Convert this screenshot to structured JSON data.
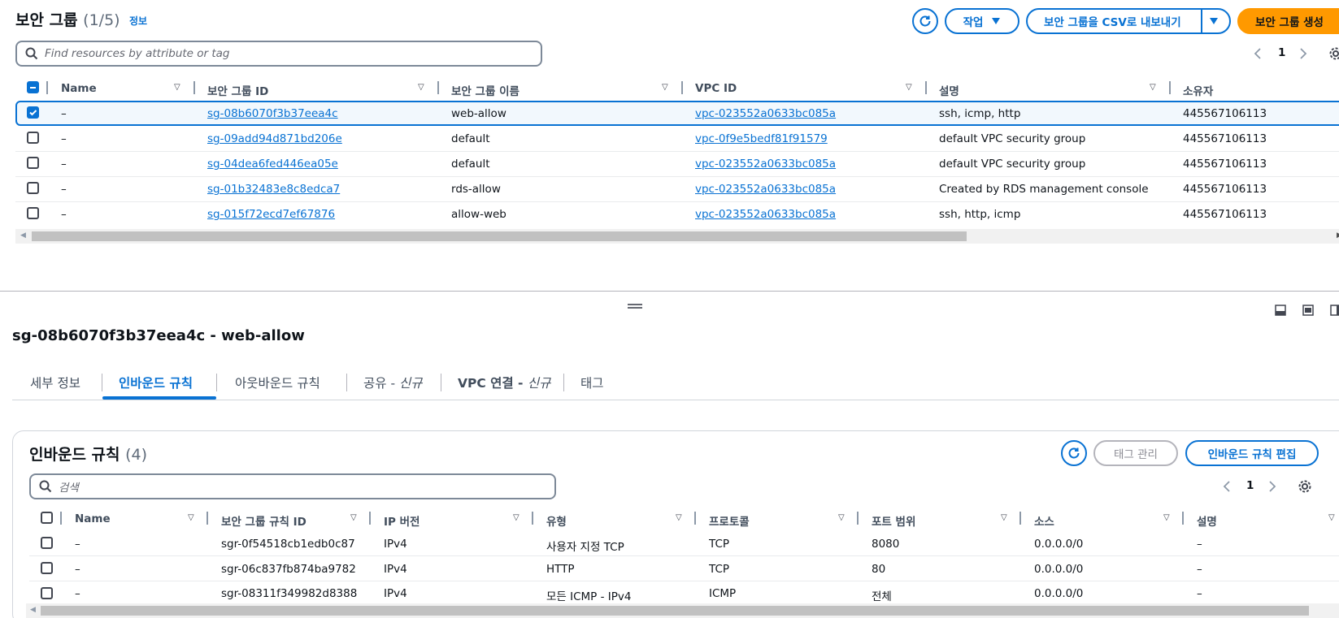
{
  "top": {
    "title": "보안 그룹",
    "count": "(1/5)",
    "info_link": "정보",
    "actions_label": "작업",
    "export_label": "보안 그룹을 CSV로 내보내기",
    "create_label": "보안 그룹 생성",
    "search_placeholder": "Find resources by attribute or tag",
    "page": "1",
    "columns": [
      "Name",
      "보안 그룹 ID",
      "보안 그룹 이름",
      "VPC ID",
      "설명",
      "소유자"
    ],
    "rows": [
      {
        "name": "–",
        "id": "sg-08b6070f3b37eea4c",
        "group_name": "web-allow",
        "vpc": "vpc-023552a0633bc085a",
        "desc": "ssh, icmp, http",
        "owner": "445567106113",
        "selected": true
      },
      {
        "name": "–",
        "id": "sg-09add94d871bd206e",
        "group_name": "default",
        "vpc": "vpc-0f9e5bedf81f91579",
        "desc": "default VPC security group",
        "owner": "445567106113",
        "selected": false
      },
      {
        "name": "–",
        "id": "sg-04dea6fed446ea05e",
        "group_name": "default",
        "vpc": "vpc-023552a0633bc085a",
        "desc": "default VPC security group",
        "owner": "445567106113",
        "selected": false
      },
      {
        "name": "–",
        "id": "sg-01b32483e8c8edca7",
        "group_name": "rds-allow",
        "vpc": "vpc-023552a0633bc085a",
        "desc": "Created by RDS management console",
        "owner": "445567106113",
        "selected": false
      },
      {
        "name": "–",
        "id": "sg-015f72ecd7ef67876",
        "group_name": "allow-web",
        "vpc": "vpc-023552a0633bc085a",
        "desc": "ssh, http, icmp",
        "owner": "445567106113",
        "selected": false
      }
    ]
  },
  "detail": {
    "title": "sg-08b6070f3b37eea4c - web-allow",
    "tabs": [
      {
        "label": "세부 정보",
        "suffix": ""
      },
      {
        "label": "인바운드 규칙",
        "suffix": ""
      },
      {
        "label": "아웃바운드 규칙",
        "suffix": ""
      },
      {
        "label": "공유 - ",
        "suffix": "신규"
      },
      {
        "label": "VPC 연결 - ",
        "suffix": "신규"
      },
      {
        "label": "태그",
        "suffix": ""
      }
    ],
    "active_tab": 1
  },
  "inbound": {
    "title": "인바운드 규칙",
    "count": "(4)",
    "manage_tags_label": "태그 관리",
    "edit_label": "인바운드 규칙 편집",
    "search_placeholder": "검색",
    "page": "1",
    "columns": [
      "Name",
      "보안 그룹 규칙 ID",
      "IP 버전",
      "유형",
      "프로토콜",
      "포트 범위",
      "소스",
      "설명"
    ],
    "rows": [
      {
        "name": "–",
        "rule_id": "sgr-0f54518cb1edb0c87",
        "ip": "IPv4",
        "type": "사용자 지정 TCP",
        "protocol": "TCP",
        "port": "8080",
        "source": "0.0.0.0/0",
        "desc": "–"
      },
      {
        "name": "–",
        "rule_id": "sgr-06c837fb874ba9782",
        "ip": "IPv4",
        "type": "HTTP",
        "protocol": "TCP",
        "port": "80",
        "source": "0.0.0.0/0",
        "desc": "–"
      },
      {
        "name": "–",
        "rule_id": "sgr-08311f349982d8388",
        "ip": "IPv4",
        "type": "모든 ICMP - IPv4",
        "protocol": "ICMP",
        "port": "전체",
        "source": "0.0.0.0/0",
        "desc": "–"
      }
    ]
  },
  "colors": {
    "accent": "#0972d3",
    "primary": "#ff9900",
    "text": "#0f141a"
  },
  "icons": [
    "search-icon",
    "refresh-icon",
    "caret-down-icon",
    "settings-icon",
    "chevron-left-icon",
    "chevron-right-icon",
    "split-panel-icon",
    "drag-handle-icon"
  ]
}
